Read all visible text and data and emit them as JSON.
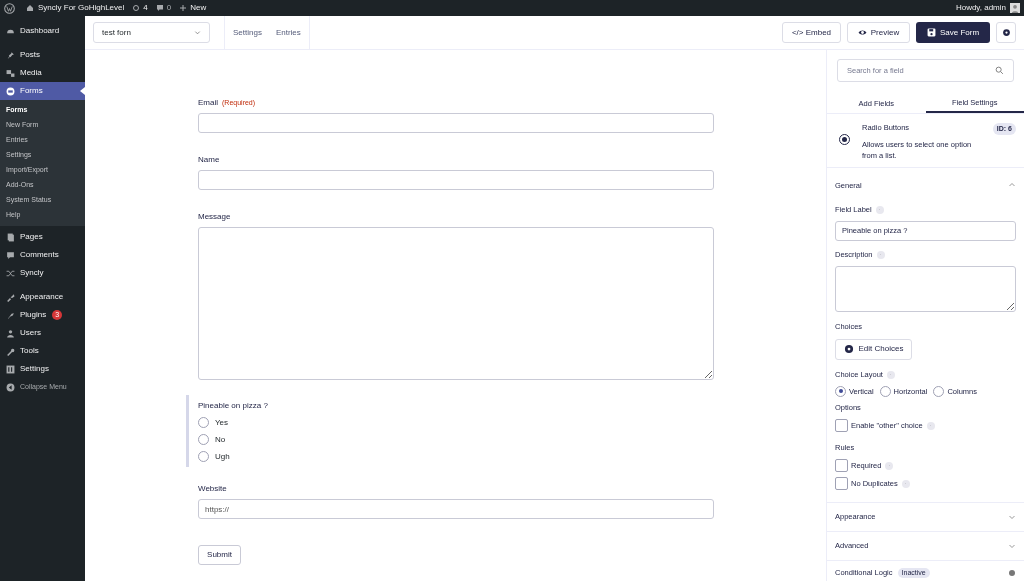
{
  "admin_bar": {
    "site_title": "Syncly For GoHighLevel",
    "updates_count": "4",
    "comments_count": "0",
    "new_label": "New",
    "greeting": "Howdy, admin"
  },
  "sidebar": {
    "items": [
      {
        "label": "Dashboard",
        "selected": false
      },
      {
        "label": "Posts",
        "selected": false
      },
      {
        "label": "Media",
        "selected": false
      },
      {
        "label": "Forms",
        "selected": true,
        "children": [
          {
            "label": "Forms",
            "selected": true
          },
          {
            "label": "New Form",
            "selected": false
          },
          {
            "label": "Entries",
            "selected": false
          },
          {
            "label": "Settings",
            "selected": false
          },
          {
            "label": "Import/Export",
            "selected": false
          },
          {
            "label": "Add-Ons",
            "selected": false
          },
          {
            "label": "System Status",
            "selected": false
          },
          {
            "label": "Help",
            "selected": false
          }
        ]
      },
      {
        "label": "Pages",
        "selected": false
      },
      {
        "label": "Comments",
        "selected": false
      },
      {
        "label": "Syncly",
        "selected": false
      },
      {
        "label": "Appearance",
        "selected": false
      },
      {
        "label": "Plugins",
        "selected": false,
        "badge": "3"
      },
      {
        "label": "Users",
        "selected": false
      },
      {
        "label": "Tools",
        "selected": false
      },
      {
        "label": "Settings",
        "selected": false
      },
      {
        "label": "Collapse Menu",
        "selected": false
      }
    ]
  },
  "header": {
    "form_selector": "test forn",
    "links": [
      "Settings",
      "Entries"
    ],
    "buttons": [
      {
        "label": "</> Embed",
        "kind": "plain"
      },
      {
        "label": "Preview",
        "kind": "preview"
      },
      {
        "label": "Save Form",
        "kind": "primary"
      }
    ]
  },
  "form": {
    "fields": [
      {
        "kind": "text",
        "label": "Email",
        "required_note": "(Required)",
        "selected": false
      },
      {
        "kind": "text",
        "label": "Name",
        "selected": false
      },
      {
        "kind": "textarea",
        "label": "Message",
        "selected": false
      },
      {
        "kind": "radio",
        "label": "Pineable on pizza ?",
        "selected": true,
        "choices": [
          {
            "label": "Yes",
            "selected": false
          },
          {
            "label": "No",
            "selected": false
          },
          {
            "label": "Ugh",
            "selected": false
          }
        ]
      },
      {
        "kind": "text",
        "label": "Website",
        "value": "https://",
        "selected": false
      }
    ],
    "submit": "Submit"
  },
  "panel": {
    "search": {
      "placeholder": "Search for a field"
    },
    "tabs": [
      {
        "label": "Add Fields",
        "selected": false
      },
      {
        "label": "Field Settings",
        "selected": true
      }
    ],
    "field_info": {
      "title": "Radio Buttons",
      "description": "Allows users to select one option from a list.",
      "id": "ID: 6"
    },
    "general": {
      "title": "General",
      "expanded": true,
      "field_label": "Field Label",
      "field_label_value": "Pineable on pizza ?",
      "description_label": "Description",
      "choices_label": "Choices",
      "edit_choices": "Edit Choices",
      "choice_layout_label": "Choice Layout",
      "layouts": [
        {
          "label": "Vertical",
          "selected": true
        },
        {
          "label": "Horizontal",
          "selected": false
        },
        {
          "label": "Columns",
          "selected": false
        }
      ],
      "options_label": "Options",
      "options": [
        {
          "label": "Enable \"other\" choice",
          "checked": false
        }
      ],
      "rules_label": "Rules",
      "rules": [
        {
          "label": "Required",
          "checked": false
        },
        {
          "label": "No Duplicates",
          "checked": false
        }
      ]
    },
    "sections": [
      {
        "title": "Appearance",
        "expanded": false
      },
      {
        "title": "Advanced",
        "expanded": false
      }
    ],
    "conditional_logic": {
      "title": "Conditional Logic",
      "status": "Inactive"
    }
  }
}
